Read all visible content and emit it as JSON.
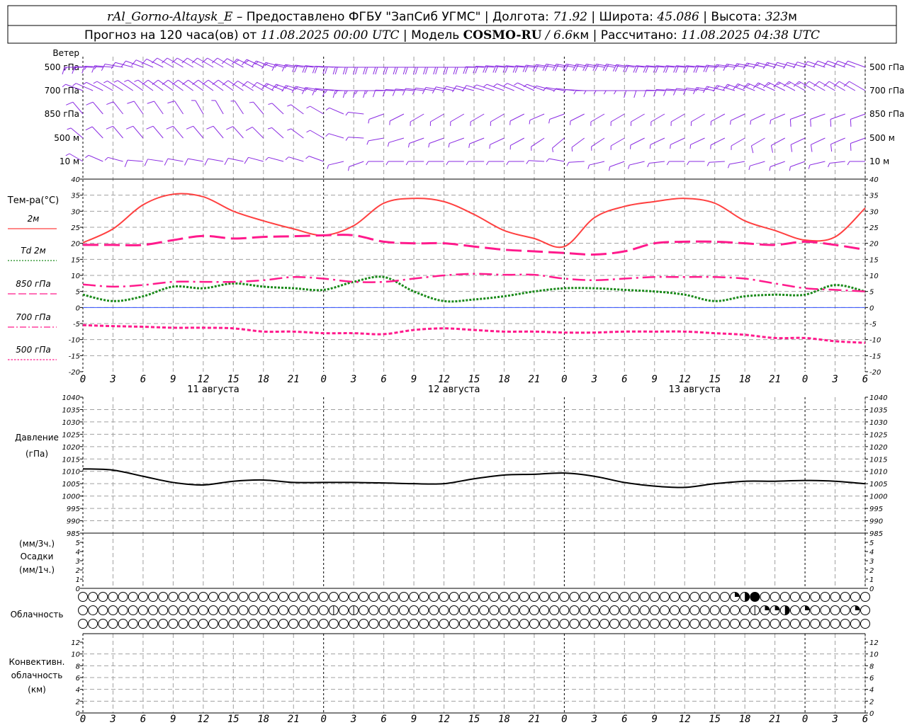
{
  "header": {
    "station": "rAl_Gorno-Altaysk_E",
    "provider": " – Предоставлено ФГБУ \"ЗапСиб УГМС\" | Долгота: ",
    "lon": "71.92",
    "lat_label": " | Широта: ",
    "lat": "45.086",
    "alt_label": " | Высота: ",
    "alt": "323",
    "alt_unit": "м",
    "forecast_label": "Прогноз на 120 часа(ов) от ",
    "forecast_start": "11.08.2025 00:00 UTC",
    "model_label": " | Модель ",
    "model": "COSMO-RU",
    "resolution": " / 6.6",
    "res_unit": "км",
    "calc_label": " | Рассчитано: ",
    "calc_time": "11.08.2025 04:38 UTC"
  },
  "labels": {
    "wind": "Ветер",
    "wind_levels": [
      "500 гПа",
      "700 гПа",
      "850 гПа",
      "500 м",
      "10 м"
    ],
    "temp": "Тем-ра(°C)",
    "legend": [
      "2м",
      "Td  2м",
      "850 гПа",
      "700 гПа",
      "500 гПа"
    ],
    "pressure": [
      "Давление",
      "(гПа)"
    ],
    "precip": [
      "(мм/3ч.)",
      "Осадки",
      "(мм/1ч.)"
    ],
    "cloud": "Облачность",
    "conv": [
      "Конвективн.",
      "облачность",
      "(км)"
    ]
  },
  "colors": {
    "wind": "#8a2be2",
    "t2m": "#ff4040",
    "td2m": "#1a8a1a",
    "t850": "#ff1a8c",
    "t700": "#ff1a8c",
    "t500": "#ff1a8c",
    "zero_line": "#3050ff",
    "pressure": "#000000",
    "grid": "#a0a0a0"
  },
  "chart_data": {
    "type": "line",
    "x_hours": [
      0,
      3,
      6,
      9,
      12,
      15,
      18,
      21,
      24,
      27,
      30,
      33,
      36,
      39,
      42,
      45,
      48,
      51,
      54,
      57,
      60,
      63,
      66,
      69,
      72,
      75,
      78
    ],
    "x_tick_labels": [
      "0",
      "3",
      "6",
      "9",
      "12",
      "15",
      "18",
      "21",
      "0",
      "3",
      "6",
      "9",
      "12",
      "15",
      "18",
      "21",
      "0",
      "3",
      "6",
      "9",
      "12",
      "15",
      "18",
      "21",
      "0",
      "3",
      "6"
    ],
    "day_labels": [
      {
        "hour": 13,
        "text": "11 августа"
      },
      {
        "hour": 37,
        "text": "12 августа"
      },
      {
        "hour": 61,
        "text": "13 августа"
      }
    ],
    "temperature": {
      "ylim": [
        -20,
        40
      ],
      "ticks": [
        40,
        35,
        30,
        25,
        20,
        15,
        10,
        5,
        0,
        -5,
        -10,
        -15,
        -20
      ],
      "series": [
        {
          "name": "2м",
          "values": [
            20.2,
            24.5,
            32,
            35.3,
            34.5,
            30,
            27,
            24.5,
            22.5,
            25.5,
            32.5,
            34,
            33,
            29,
            24,
            21.5,
            19,
            28,
            31.5,
            33,
            34,
            32.5,
            27,
            24,
            21,
            22,
            31
          ]
        },
        {
          "name": "Td  2м",
          "values": [
            4,
            2,
            3.5,
            6.5,
            6,
            7.5,
            6.5,
            6,
            5.5,
            8,
            9.5,
            5,
            2,
            2.5,
            3.5,
            5,
            6,
            6,
            5.5,
            5,
            4,
            2,
            3.5,
            4,
            4,
            7,
            5
          ]
        },
        {
          "name": "850 гПа",
          "values": [
            19.5,
            19.5,
            19.5,
            21,
            22.3,
            21.5,
            22,
            22.2,
            22.5,
            22.5,
            20.5,
            20,
            20,
            19,
            18,
            17.5,
            17,
            16.5,
            17.5,
            20,
            20.5,
            20.5,
            20,
            19.5,
            20.5,
            19.5,
            18
          ]
        },
        {
          "name": "700 гПа",
          "values": [
            7.2,
            6.5,
            7,
            8,
            8,
            8,
            8.5,
            9.5,
            9,
            8,
            8,
            9,
            10,
            10.5,
            10.2,
            10.2,
            9,
            8.5,
            9,
            9.5,
            9.5,
            9.5,
            9,
            7.5,
            6,
            5.5,
            5
          ]
        },
        {
          "name": "500 гПа",
          "values": [
            -5.5,
            -5.8,
            -6,
            -6.3,
            -6.3,
            -6.5,
            -7.5,
            -7.5,
            -8,
            -8,
            -8.3,
            -7,
            -6.5,
            -7,
            -7.5,
            -7.5,
            -7.8,
            -7.8,
            -7.5,
            -7.5,
            -7.5,
            -8,
            -8.5,
            -9.5,
            -9.5,
            -10.5,
            -11
          ]
        }
      ]
    },
    "pressure": {
      "ylim": [
        985,
        1040
      ],
      "ticks": [
        1040,
        1035,
        1030,
        1025,
        1020,
        1015,
        1010,
        1005,
        1000,
        995,
        990,
        985
      ],
      "values": [
        1011,
        1010.5,
        1008,
        1005.5,
        1004.5,
        1006,
        1006.5,
        1005.5,
        1005.5,
        1005.5,
        1005.3,
        1005,
        1005,
        1007,
        1008.5,
        1008.8,
        1009.3,
        1008,
        1005.5,
        1004,
        1003.5,
        1005,
        1006,
        1006,
        1006.3,
        1006,
        1005
      ]
    },
    "precip": {
      "ylim": [
        0,
        5
      ],
      "ticks": [
        5,
        4,
        3,
        2,
        1,
        0
      ],
      "values": [
        0,
        0,
        0,
        0,
        0,
        0,
        0,
        0,
        0,
        0,
        0,
        0,
        0,
        0,
        0,
        0,
        0,
        0,
        0,
        0,
        0,
        0,
        0,
        0,
        0,
        0,
        0
      ]
    },
    "cloud_hourly": {
      "rows": 3,
      "hours": 79,
      "nonzero": [
        {
          "row": 0,
          "hour": 65,
          "cover": 0.25
        },
        {
          "row": 0,
          "hour": 66,
          "cover": 0.5
        },
        {
          "row": 0,
          "hour": 67,
          "cover": 1
        },
        {
          "row": 1,
          "hour": 25,
          "cover": 0.1
        },
        {
          "row": 1,
          "hour": 27,
          "cover": 0.1
        },
        {
          "row": 1,
          "hour": 67,
          "cover": 0.1
        },
        {
          "row": 1,
          "hour": 68,
          "cover": 0.25
        },
        {
          "row": 1,
          "hour": 69,
          "cover": 0.25
        },
        {
          "row": 1,
          "hour": 70,
          "cover": 0.5
        },
        {
          "row": 1,
          "hour": 72,
          "cover": 0.25
        },
        {
          "row": 1,
          "hour": 77,
          "cover": 0.25
        }
      ]
    },
    "convective": {
      "ylim": [
        0,
        12
      ],
      "ticks": [
        12,
        10,
        8,
        6,
        4,
        2,
        0
      ],
      "values": []
    },
    "wind": {
      "levels": [
        "500 гПа",
        "700 гПа",
        "850 гПа",
        "500 м",
        "10 м"
      ],
      "direction_deg": [
        [
          270,
          275,
          290,
          300,
          300,
          300,
          295,
          280,
          275,
          270,
          270,
          270,
          270,
          270,
          275,
          275,
          280,
          280,
          280,
          275,
          275,
          275,
          280,
          285,
          285,
          290,
          290
        ],
        [
          290,
          300,
          305,
          305,
          305,
          305,
          300,
          290,
          280,
          270,
          270,
          275,
          280,
          285,
          290,
          295,
          280,
          270,
          270,
          270,
          275,
          280,
          290,
          295,
          300,
          300,
          300
        ],
        [
          320,
          320,
          325,
          325,
          330,
          330,
          320,
          310,
          300,
          290,
          250,
          240,
          240,
          240,
          240,
          245,
          250,
          240,
          240,
          240,
          240,
          240,
          245,
          245,
          250,
          250,
          250
        ],
        [
          310,
          320,
          320,
          320,
          320,
          320,
          315,
          310,
          300,
          280,
          260,
          250,
          250,
          250,
          245,
          240,
          230,
          235,
          240,
          245,
          245,
          245,
          240,
          240,
          245,
          245,
          250
        ],
        [
          300,
          290,
          275,
          280,
          280,
          280,
          285,
          285,
          290,
          240,
          270,
          270,
          270,
          270,
          270,
          270,
          280,
          260,
          250,
          260,
          270,
          270,
          260,
          250,
          250,
          260,
          270
        ]
      ],
      "speed_ms": [
        [
          15,
          15,
          10,
          10,
          10,
          12,
          15,
          18,
          20,
          20,
          20,
          20,
          20,
          20,
          22,
          22,
          20,
          20,
          20,
          20,
          20,
          20,
          18,
          15,
          12,
          12,
          10
        ],
        [
          8,
          8,
          8,
          10,
          10,
          10,
          12,
          15,
          15,
          15,
          15,
          10,
          10,
          10,
          8,
          8,
          8,
          8,
          8,
          10,
          12,
          14,
          15,
          15,
          15,
          12,
          10
        ],
        [
          10,
          10,
          10,
          10,
          8,
          8,
          8,
          8,
          6,
          5,
          5,
          6,
          8,
          8,
          8,
          6,
          6,
          8,
          8,
          8,
          8,
          8,
          8,
          8,
          10,
          10,
          10
        ],
        [
          8,
          10,
          10,
          10,
          10,
          10,
          10,
          8,
          6,
          5,
          8,
          8,
          8,
          8,
          8,
          8,
          8,
          8,
          8,
          8,
          8,
          8,
          8,
          10,
          10,
          10,
          10
        ],
        [
          5,
          8,
          10,
          10,
          10,
          10,
          10,
          8,
          6,
          5,
          5,
          5,
          5,
          5,
          5,
          5,
          5,
          5,
          5,
          5,
          5,
          5,
          5,
          5,
          5,
          5,
          5
        ]
      ]
    }
  }
}
